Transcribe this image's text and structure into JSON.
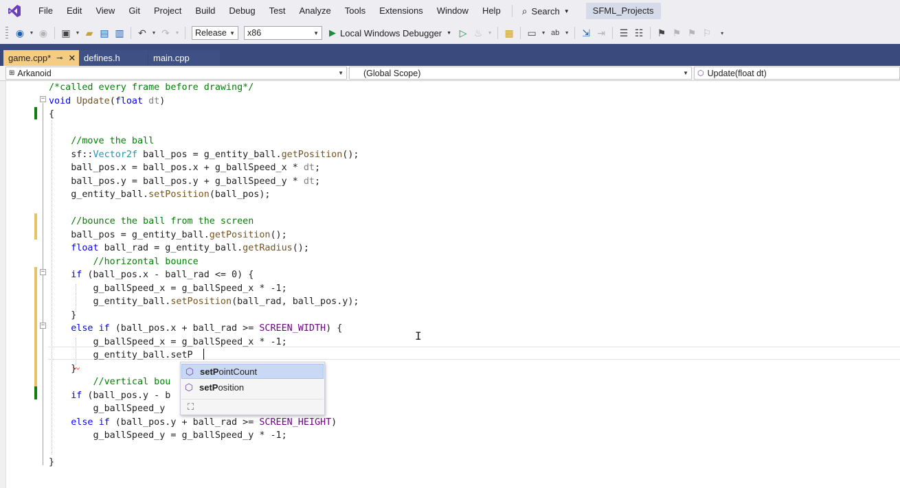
{
  "menubar": {
    "items": [
      "File",
      "Edit",
      "View",
      "Git",
      "Project",
      "Build",
      "Debug",
      "Test",
      "Analyze",
      "Tools",
      "Extensions",
      "Window",
      "Help"
    ],
    "search_label": "Search",
    "solution_name": "SFML_Projects",
    "logo_color": "#6c3fbf"
  },
  "toolbar": {
    "configuration": "Release",
    "platform": "x86",
    "debugger": "Local Windows Debugger",
    "run_color": "#1f8a3b"
  },
  "tabs": [
    {
      "label": "game.cpp*",
      "active": true,
      "pin_icon": "pin-icon",
      "close_icon": "close-icon"
    },
    {
      "label": "defines.h",
      "active": false
    },
    {
      "label": "main.cpp",
      "active": false
    }
  ],
  "navbar": {
    "project": "Arkanoid",
    "scope": "(Global Scope)",
    "member": "Update(float dt)"
  },
  "editor": {
    "code": [
      [
        [
          "cm",
          "/*called every frame before drawing*/"
        ]
      ],
      [
        [
          "kw",
          "void"
        ],
        [
          "",
          " "
        ],
        [
          "fn",
          "Update"
        ],
        [
          "",
          "("
        ],
        [
          "kw",
          "float"
        ],
        [
          "",
          " "
        ],
        [
          "pm",
          "dt"
        ],
        [
          "",
          ")"
        ]
      ],
      [
        [
          "",
          "{"
        ]
      ],
      [],
      [
        [
          "",
          "    "
        ],
        [
          "cm",
          "//move the ball"
        ]
      ],
      [
        [
          "",
          "    sf::"
        ],
        [
          "ty",
          "Vector2f"
        ],
        [
          "",
          " ball_pos = g_entity_ball."
        ],
        [
          "fn",
          "getPosition"
        ],
        [
          "",
          "();"
        ]
      ],
      [
        [
          "",
          "    ball_pos.x = ball_pos.x + g_ballSpeed_x * "
        ],
        [
          "pm",
          "dt"
        ],
        [
          "",
          ";"
        ]
      ],
      [
        [
          "",
          "    ball_pos.y = ball_pos.y + g_ballSpeed_y * "
        ],
        [
          "pm",
          "dt"
        ],
        [
          "",
          ";"
        ]
      ],
      [
        [
          "",
          "    g_entity_ball."
        ],
        [
          "fn",
          "setPosition"
        ],
        [
          "",
          "(ball_pos);"
        ]
      ],
      [],
      [
        [
          "",
          "    "
        ],
        [
          "cm",
          "//bounce the ball from the screen"
        ]
      ],
      [
        [
          "",
          "    ball_pos = g_entity_ball."
        ],
        [
          "fn",
          "getPosition"
        ],
        [
          "",
          "();"
        ]
      ],
      [
        [
          "",
          "    "
        ],
        [
          "kw",
          "float"
        ],
        [
          "",
          " ball_rad = g_entity_ball."
        ],
        [
          "fn",
          "getRadius"
        ],
        [
          "",
          "();"
        ]
      ],
      [
        [
          "",
          "        "
        ],
        [
          "cm",
          "//horizontal bounce"
        ]
      ],
      [
        [
          "",
          "    "
        ],
        [
          "kw",
          "if"
        ],
        [
          "",
          " (ball_pos.x - ball_rad <= 0) {"
        ]
      ],
      [
        [
          "",
          "        g_ballSpeed_x = g_ballSpeed_x * -1;"
        ]
      ],
      [
        [
          "",
          "        g_entity_ball."
        ],
        [
          "fn",
          "setPosition"
        ],
        [
          "",
          "(ball_rad, ball_pos.y);"
        ]
      ],
      [
        [
          "",
          "    }"
        ]
      ],
      [
        [
          "",
          "    "
        ],
        [
          "kw",
          "else"
        ],
        [
          "",
          " "
        ],
        [
          "kw",
          "if"
        ],
        [
          "",
          " (ball_pos.x + ball_rad >= "
        ],
        [
          "mc",
          "SCREEN_WIDTH"
        ],
        [
          "",
          ") {"
        ]
      ],
      [
        [
          "",
          "        g_ballSpeed_x = g_ballSpeed_x * -1;"
        ]
      ],
      [
        [
          "",
          "        g_entity_ball.setP"
        ]
      ],
      [
        [
          "",
          "    }"
        ]
      ],
      [
        [
          "",
          "        "
        ],
        [
          "cm",
          "//vertical bou"
        ]
      ],
      [
        [
          "",
          "    "
        ],
        [
          "kw",
          "if"
        ],
        [
          "",
          " (ball_pos.y - b"
        ]
      ],
      [
        [
          "",
          "        g_ballSpeed_y "
        ]
      ],
      [
        [
          "",
          "    "
        ],
        [
          "kw",
          "else"
        ],
        [
          "",
          " "
        ],
        [
          "kw",
          "if"
        ],
        [
          "",
          " (ball_pos.y + ball_rad >= "
        ],
        [
          "mc",
          "SCREEN_HEIGHT"
        ],
        [
          "",
          ")"
        ]
      ],
      [
        [
          "",
          "        g_ballSpeed_y = g_ballSpeed_y * -1;"
        ]
      ],
      [],
      [
        [
          "",
          "}"
        ]
      ]
    ]
  },
  "intellisense": {
    "typed_prefix": "setP",
    "items": [
      {
        "match": "setP",
        "rest": "ointCount",
        "selected": true,
        "icon": "method-cube-icon"
      },
      {
        "match": "setP",
        "rest": "osition",
        "selected": false,
        "icon": "method-cube-icon"
      }
    ],
    "filter_icon": "filter-members-icon"
  }
}
